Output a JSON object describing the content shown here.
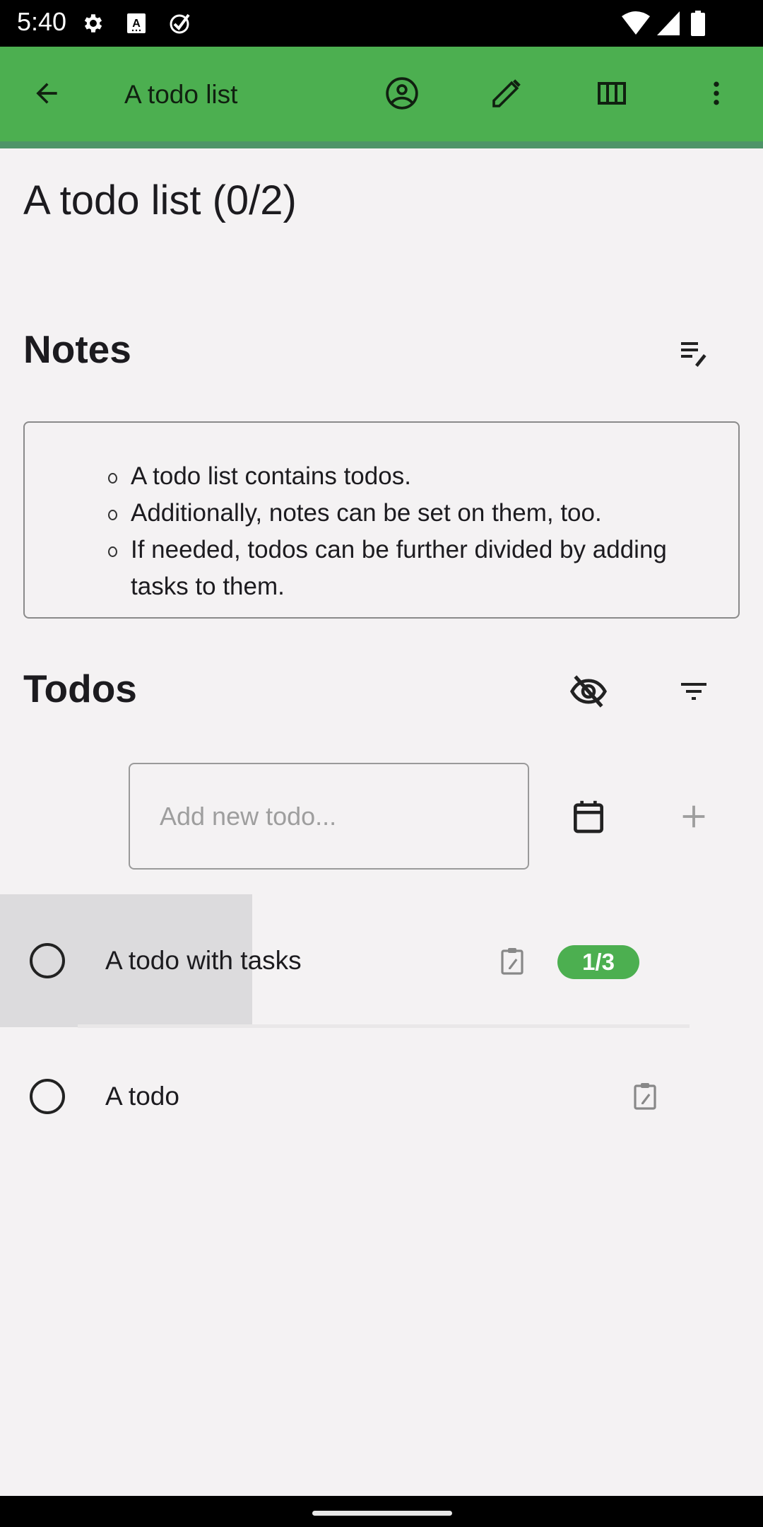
{
  "status_bar": {
    "time": "5:40",
    "left_icons": [
      "settings-icon",
      "keyboard-a-icon",
      "check-badge-icon"
    ],
    "right_icons": [
      "wifi-icon",
      "cell-signal-icon",
      "battery-icon"
    ]
  },
  "toolbar": {
    "title": "A todo list",
    "back_icon": "arrow-left-icon",
    "actions": [
      "account-circle-icon",
      "pencil-icon",
      "columns-icon",
      "more-vert-icon"
    ],
    "color": "#4caf50"
  },
  "page": {
    "title": "A todo list (0/2)"
  },
  "notes": {
    "heading": "Notes",
    "edit_icon": "edit-notes-icon",
    "items": [
      "A todo list contains todos.",
      "Additionally, notes can be set on them, too.",
      "If needed, todos can be further divided by adding tasks to them."
    ]
  },
  "todos": {
    "heading": "Todos",
    "hide_done_icon": "eye-off-icon",
    "filter_icon": "filter-icon",
    "add_input": {
      "value": "",
      "placeholder": "Add new todo..."
    },
    "calendar_icon": "calendar-icon",
    "add_icon": "plus-icon",
    "items": [
      {
        "label": "A todo with tasks",
        "done": false,
        "has_notes_icon": true,
        "progress": "1/3",
        "progress_fraction": 0.333
      },
      {
        "label": "A todo",
        "done": false,
        "has_notes_icon": true
      }
    ]
  }
}
